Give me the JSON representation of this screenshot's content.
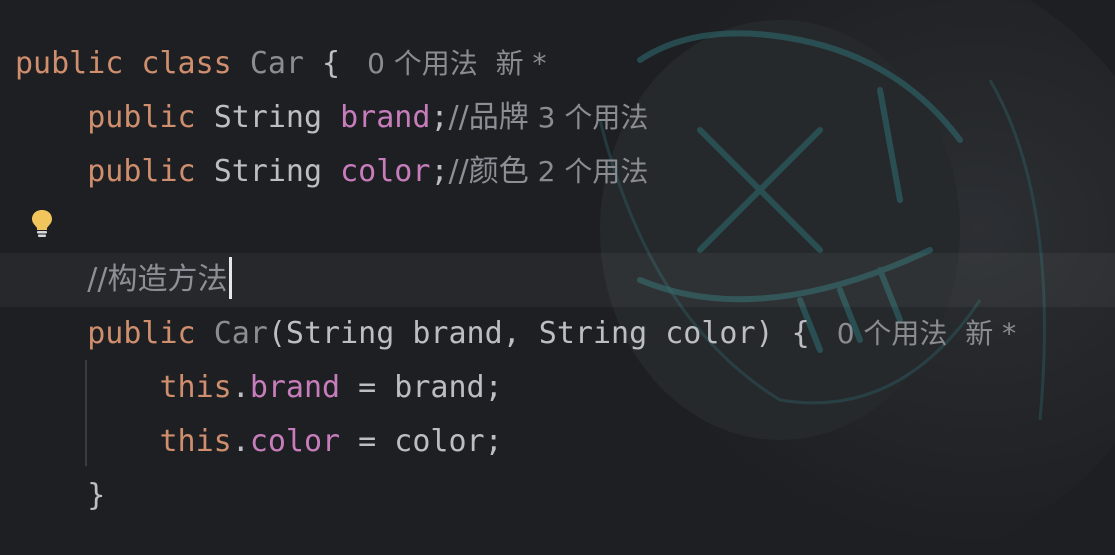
{
  "editor": {
    "lines": [
      {
        "tokens": [
          {
            "t": "public class ",
            "k": "kw"
          },
          {
            "t": "Car",
            "k": "cls"
          },
          {
            "t": " { ",
            "k": "plain"
          }
        ],
        "hint": "0 个用法  新 *"
      },
      {
        "tokens": [
          {
            "t": "    public ",
            "k": "kw"
          },
          {
            "t": "String ",
            "k": "plain"
          },
          {
            "t": "brand",
            "k": "field"
          },
          {
            "t": ";",
            "k": "plain"
          },
          {
            "t": "//品牌",
            "k": "cmt"
          }
        ],
        "hint": "3 个用法"
      },
      {
        "tokens": [
          {
            "t": "    public ",
            "k": "kw"
          },
          {
            "t": "String ",
            "k": "plain"
          },
          {
            "t": "color",
            "k": "field"
          },
          {
            "t": ";",
            "k": "plain"
          },
          {
            "t": "//颜色",
            "k": "cmt"
          }
        ],
        "hint": "2 个用法"
      },
      {
        "tokens": [],
        "hint": ""
      },
      {
        "tokens": [
          {
            "t": "    ",
            "k": "plain"
          },
          {
            "t": "//构造方法",
            "k": "cmt"
          }
        ],
        "hint": "",
        "current": true
      },
      {
        "tokens": [
          {
            "t": "    public ",
            "k": "kw"
          },
          {
            "t": "Car",
            "k": "cls"
          },
          {
            "t": "(String brand, String color) { ",
            "k": "plain"
          }
        ],
        "hint": "0 个用法  新 *"
      },
      {
        "tokens": [
          {
            "t": "        this",
            "k": "kw"
          },
          {
            "t": ".",
            "k": "plain"
          },
          {
            "t": "brand",
            "k": "field"
          },
          {
            "t": " = brand;",
            "k": "plain"
          }
        ],
        "hint": ""
      },
      {
        "tokens": [
          {
            "t": "        this",
            "k": "kw"
          },
          {
            "t": ".",
            "k": "plain"
          },
          {
            "t": "color",
            "k": "field"
          },
          {
            "t": " = color;",
            "k": "plain"
          }
        ],
        "hint": ""
      },
      {
        "tokens": [
          {
            "t": "    }",
            "k": "plain"
          }
        ],
        "hint": ""
      }
    ],
    "gutter_icon": "lightbulb-icon",
    "colors": {
      "background": "#1e1f22",
      "keyword": "#cf8e6d",
      "field": "#c77dbb",
      "class_name": "#8b8d92",
      "text": "#bcbec4",
      "comment": "#8c8f95",
      "inlay_hint": "#8a8c91",
      "bulb": "#f2c55c"
    }
  }
}
